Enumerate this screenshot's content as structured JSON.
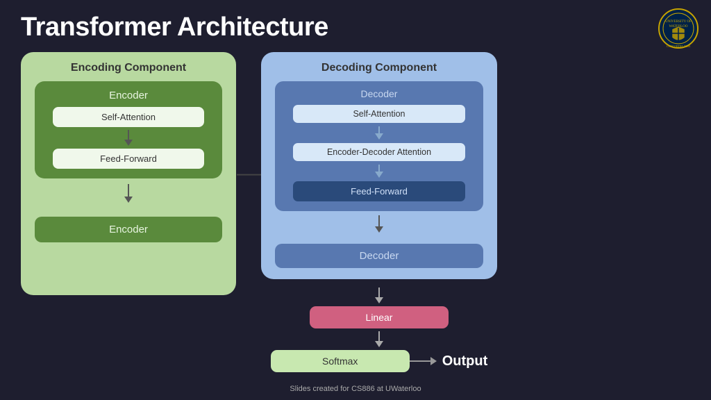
{
  "slide": {
    "title": "Transformer Architecture",
    "footer": "Slides created for CS886 at UWaterloo"
  },
  "encoding": {
    "component_label": "Encoding Component",
    "encoder_label": "Encoder",
    "self_attention": "Self-Attention",
    "feed_forward": "Feed-Forward",
    "encoder_bottom": "Encoder"
  },
  "decoding": {
    "component_label": "Decoding Component",
    "decoder_inner_label": "Decoder",
    "self_attention": "Self-Attention",
    "enc_dec_attention": "Encoder-Decoder Attention",
    "feed_forward": "Feed-Forward",
    "decoder_bottom": "Decoder"
  },
  "output": {
    "linear": "Linear",
    "softmax": "Softmax",
    "output_label": "Output"
  },
  "colors": {
    "encoding_bg": "#b8d9a0",
    "encoder_green": "#5a8a3c",
    "decoding_bg": "#a0bfe8",
    "decoder_blue": "#5878b0",
    "decoder_dark": "#2a4a7a",
    "linear_pink": "#d06080",
    "softmax_green": "#c8e8b0"
  }
}
